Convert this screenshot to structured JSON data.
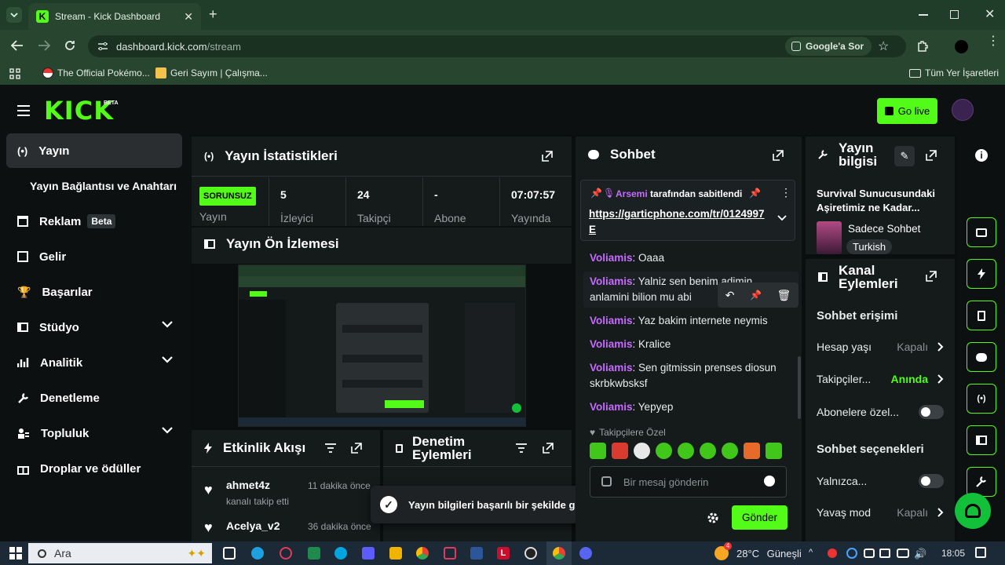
{
  "browser": {
    "tab_title": "Stream - Kick Dashboard",
    "url_domain": "dashboard.kick.com",
    "url_path": "/stream",
    "google_button": "Google'a Sor",
    "bookmarks": [
      "The Official Pokémo...",
      "Geri Sayım | Çalışma..."
    ],
    "all_bookmarks": "Tüm Yer İşaretleri"
  },
  "topbar": {
    "logo": "KICK",
    "logo_badge": "BETA",
    "go_live": "Go live"
  },
  "sidebar": {
    "items": [
      {
        "label": "Yayın",
        "icon": "broadcast-icon"
      },
      {
        "label": "Yayın Bağlantısı ve Anahtarı"
      },
      {
        "label": "Reklam",
        "badge": "Beta",
        "icon": "ad-icon"
      },
      {
        "label": "Gelir",
        "icon": "dollar-icon"
      },
      {
        "label": "Başarılar",
        "icon": "trophy-icon"
      },
      {
        "label": "Stüdyo",
        "icon": "studio-icon"
      },
      {
        "label": "Analitik",
        "icon": "analytics-icon"
      },
      {
        "label": "Denetleme",
        "icon": "wrench-icon"
      },
      {
        "label": "Topluluk",
        "icon": "community-icon"
      },
      {
        "label": "Droplar ve ödüller",
        "icon": "gift-icon"
      }
    ]
  },
  "stats": {
    "title": "Yayın İstatistikleri",
    "status": "SORUNSUZ",
    "status_label": "Yayın",
    "viewers_value": "5",
    "viewers_label": "İzleyici",
    "followers_value": "24",
    "followers_label": "Takipçi",
    "subs_value": "-",
    "subs_label": "Abone",
    "uptime_value": "07:07:57",
    "uptime_label": "Yayında"
  },
  "preview": {
    "title": "Yayın Ön İzlemesi"
  },
  "activity": {
    "title": "Etkinlik Akışı",
    "items": [
      {
        "user": "ahmet4z",
        "time": "11 dakika önce",
        "action": "kanalı takip etti"
      },
      {
        "user": "Acelya_v2",
        "time": "36 dakika önce"
      }
    ]
  },
  "mod_actions": {
    "title": "Denetim Eylemleri"
  },
  "toast": "Yayın bilgileri başarılı bir şekilde güncellendi.",
  "chat": {
    "title": "Sohbet",
    "pinned_by": "Arsemi",
    "pinned_suffix": "tarafından sabitlendi",
    "pinned_link": "https://garticphone.com/tr/0124997E",
    "messages": [
      {
        "user": "Voliamis",
        "text": "Oaaa"
      },
      {
        "user": "Voliamis",
        "text": "Yalniz sen benim adimin anlamini bilion mu abi"
      },
      {
        "user": "Voliamis",
        "text": "Yaz bakim internete neymis"
      },
      {
        "user": "Voliamis",
        "text": "Kralice"
      },
      {
        "user": "Voliamis",
        "text": "Sen gitmissin prenses diosun skrbkwbsksf"
      },
      {
        "user": "Voliamis",
        "text": "Yepyep"
      }
    ],
    "emote_section": "Takipçilere Özel",
    "input_placeholder": "Bir mesaj gönderin",
    "send": "Gönder"
  },
  "stream_info": {
    "title": "Yayın bilgisi",
    "stream_title": "Survival Sunucusundaki Aşiretimiz ne Kadar...",
    "category": "Sadece Sohbet",
    "language": "Turkish"
  },
  "channel_actions": {
    "title": "Kanal Eylemleri",
    "chat_access": "Sohbet erişimi",
    "account_age_label": "Hesap yaşı",
    "account_age_value": "Kapalı",
    "followers_label": "Takipçiler...",
    "followers_value": "Anında",
    "subs_only_label": "Abonelere özel...",
    "chat_options": "Sohbet seçenekleri",
    "only_label": "Yalnızca...",
    "slow_label": "Yavaş mod",
    "slow_value": "Kapalı"
  },
  "taskbar": {
    "search": "Ara",
    "weather_temp": "28°C",
    "weather_text": "Güneşli",
    "time": "18:05",
    "notif": "4"
  },
  "colors": {
    "kick_green": "#53fc18",
    "username": "#c56cff",
    "panel": "#151a1b"
  }
}
